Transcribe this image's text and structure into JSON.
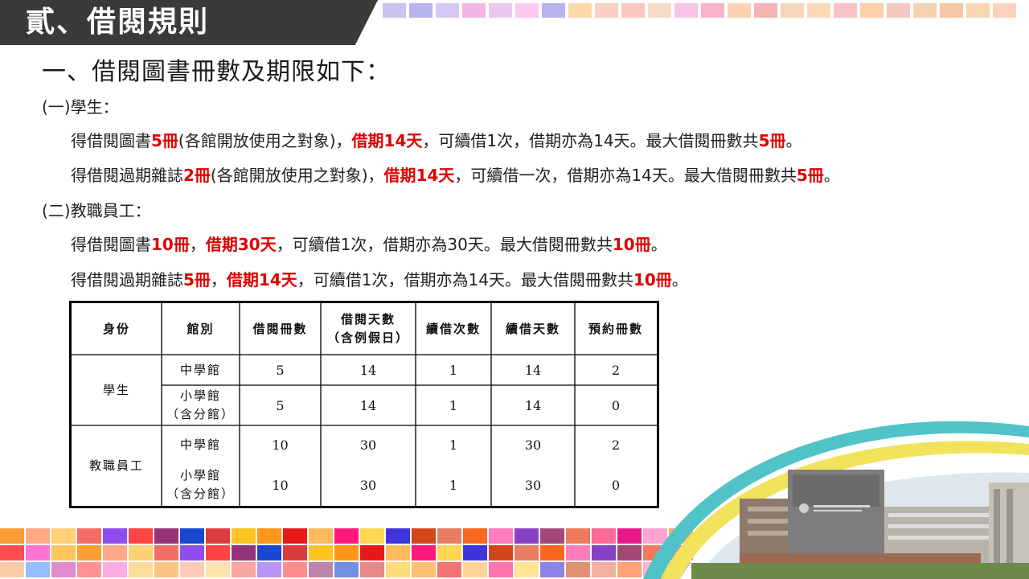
{
  "title": "貳、借閱規則",
  "heading": "一、借閱圖書冊數及期限如下：",
  "students": {
    "label": "(一)學生：",
    "line1": {
      "p1": "得借閱圖書",
      "r1": "5冊",
      "p2": "(各館開放使用之對象)，",
      "r2": "借期14天",
      "p3": "，可續借1次，借期亦為14天。最大借閱冊數共",
      "r3": "5冊",
      "p4": "。"
    },
    "line2": {
      "p1": "得借閱過期雜誌",
      "r1": "2冊",
      "p2": "(各館開放使用之對象)，",
      "r2": "借期14天",
      "p3": "，可續借一次，借期亦為14天。最大借閱冊數共",
      "r3": "5冊",
      "p4": "。"
    }
  },
  "staff": {
    "label": "(二)教職員工：",
    "line1": {
      "p1": "得借閱圖書",
      "r1": "10冊",
      "p2": "，",
      "r2": "借期30天",
      "p3": "，可續借1次，借期亦為30天。最大借閱冊數共",
      "r3": "10冊",
      "p4": "。"
    },
    "line2": {
      "p1": "得借閱過期雜誌",
      "r1": "5冊",
      "p2": "，",
      "r2": "借期14天",
      "p3": "，可續借1次，借期亦為14天。最大借閱冊數共",
      "r3": "10冊",
      "p4": "。"
    }
  },
  "table": {
    "headers": [
      "身份",
      "館別",
      "借閱冊數",
      "借閱天數\n（含例假日）",
      "續借次數",
      "續借天數",
      "預約冊數"
    ],
    "groups": [
      {
        "identity": "學生",
        "rows": [
          {
            "branch": "中學館",
            "borrow": "5",
            "days": "14",
            "renew": "1",
            "renew_days": "14",
            "reserve": "2"
          },
          {
            "branch": "小學館\n（含分館）",
            "borrow": "5",
            "days": "14",
            "renew": "1",
            "renew_days": "14",
            "reserve": "0"
          }
        ]
      },
      {
        "identity": "教職員工",
        "rows": [
          {
            "branch": "中學館",
            "borrow": "10",
            "days": "30",
            "renew": "1",
            "renew_days": "30",
            "reserve": "2"
          },
          {
            "branch": "小學館\n（含分館）",
            "borrow": "10",
            "days": "30",
            "renew": "1",
            "renew_days": "30",
            "reserve": "0"
          }
        ]
      }
    ]
  },
  "colors": {
    "title_bg": "#3a3a3a",
    "accent_red": "#e00000",
    "swoosh_teal": "#4fc3c8",
    "swoosh_yellow": "#f2e35c"
  }
}
